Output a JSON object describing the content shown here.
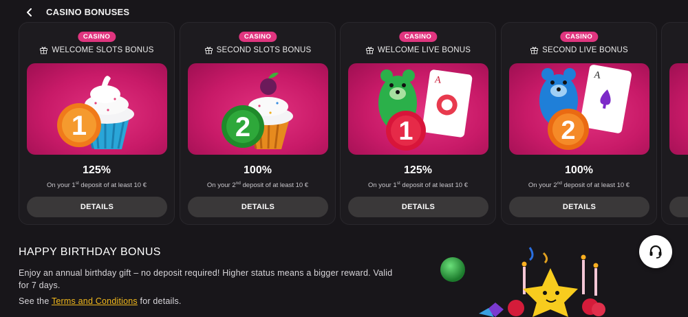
{
  "header": {
    "title": "CASINO BONUSES"
  },
  "cards": [
    {
      "badge": "CASINO",
      "title": "WELCOME SLOTS BONUS",
      "percent": "125%",
      "desc_prefix": "On your 1",
      "desc_sup": "st",
      "desc_suffix": " deposit of at least 10 €",
      "button": "DETAILS",
      "art": "cupcake-1",
      "number": "1"
    },
    {
      "badge": "CASINO",
      "title": "SECOND SLOTS BONUS",
      "percent": "100%",
      "desc_prefix": "On your 2",
      "desc_sup": "nd",
      "desc_suffix": " deposit of at least 10 €",
      "button": "DETAILS",
      "art": "cupcake-2",
      "number": "2"
    },
    {
      "badge": "CASINO",
      "title": "WELCOME LIVE BONUS",
      "percent": "125%",
      "desc_prefix": "On your 1",
      "desc_sup": "st",
      "desc_suffix": " deposit of at least 10 €",
      "button": "DETAILS",
      "art": "bear-card-1",
      "number": "1"
    },
    {
      "badge": "CASINO",
      "title": "SECOND LIVE BONUS",
      "percent": "100%",
      "desc_prefix": "On your 2",
      "desc_sup": "nd",
      "desc_suffix": " deposit of at least 10 €",
      "button": "DETAILS",
      "art": "bear-card-2",
      "number": "2"
    }
  ],
  "birthday": {
    "title": "HAPPY BIRTHDAY BONUS",
    "text": "Enjoy an annual birthday gift – no deposit required! Higher status means a bigger reward. Valid for 7 days.",
    "terms_prefix": "See the ",
    "terms_link": "Terms and Conditions",
    "terms_suffix": " for details."
  },
  "colors": {
    "accent": "#e0357f",
    "link": "#f2b91c",
    "background": "#18161a"
  },
  "icons": {
    "back": "chevron-left-icon",
    "gift": "gift-icon",
    "support": "headset-icon"
  }
}
